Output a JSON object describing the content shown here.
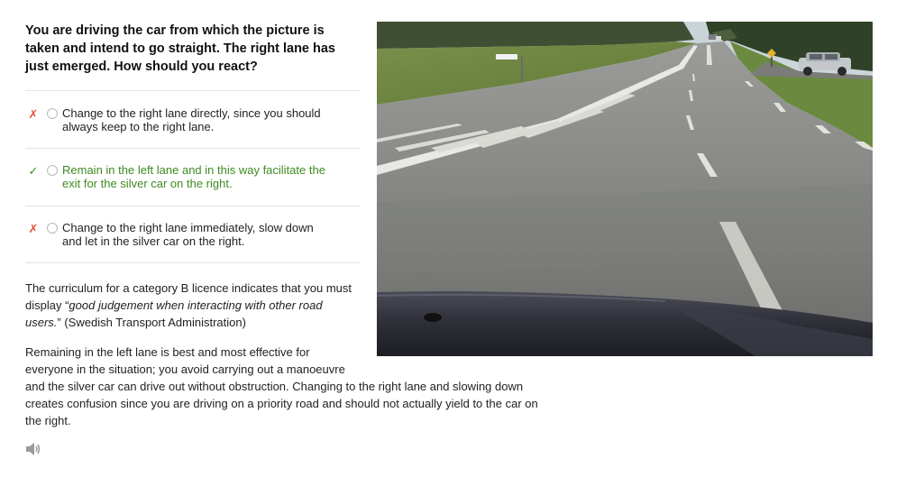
{
  "question": {
    "text": "You are driving the car from which the picture is taken and intend to go straight. The right lane has just emerged. How should you react?"
  },
  "answers": [
    {
      "status": "wrong",
      "mark": "✗",
      "line1": "Change to the right lane directly, since you should",
      "line2": "always keep to the right lane."
    },
    {
      "status": "correct",
      "mark": "✓",
      "line1": "Remain in the left lane and in this way facilitate the",
      "line2": "exit for the silver car on the right."
    },
    {
      "status": "wrong",
      "mark": "✗",
      "line1": "Change to the right lane immediately, slow down",
      "line2": "and let in the silver car on the right."
    }
  ],
  "explanation": {
    "p1_before": "The curriculum for a category B licence indicates that you must display “",
    "p1_italic": "good judgement when interacting with other road users.",
    "p1_after": "” (Swedish Transport Administration)",
    "p2_line1": "Remaining in the left lane is best and most effective for",
    "p2_line2": "everyone in the situation; you avoid carrying out a manoeuvre",
    "p2_line3": "and the silver car can drive out without obstruction. Changing to the right lane and slowing down",
    "p2_line4": "creates confusion since you are driving on a priority road and should not actually yield to the car on",
    "p2_line5": "the right."
  },
  "colors": {
    "correct": "#3f8a22",
    "wrong": "#e0543c",
    "divider": "#e3e3e3"
  },
  "icons": {
    "audio": "speaker-icon",
    "wrong_mark": "cross-icon",
    "correct_mark": "check-icon"
  }
}
